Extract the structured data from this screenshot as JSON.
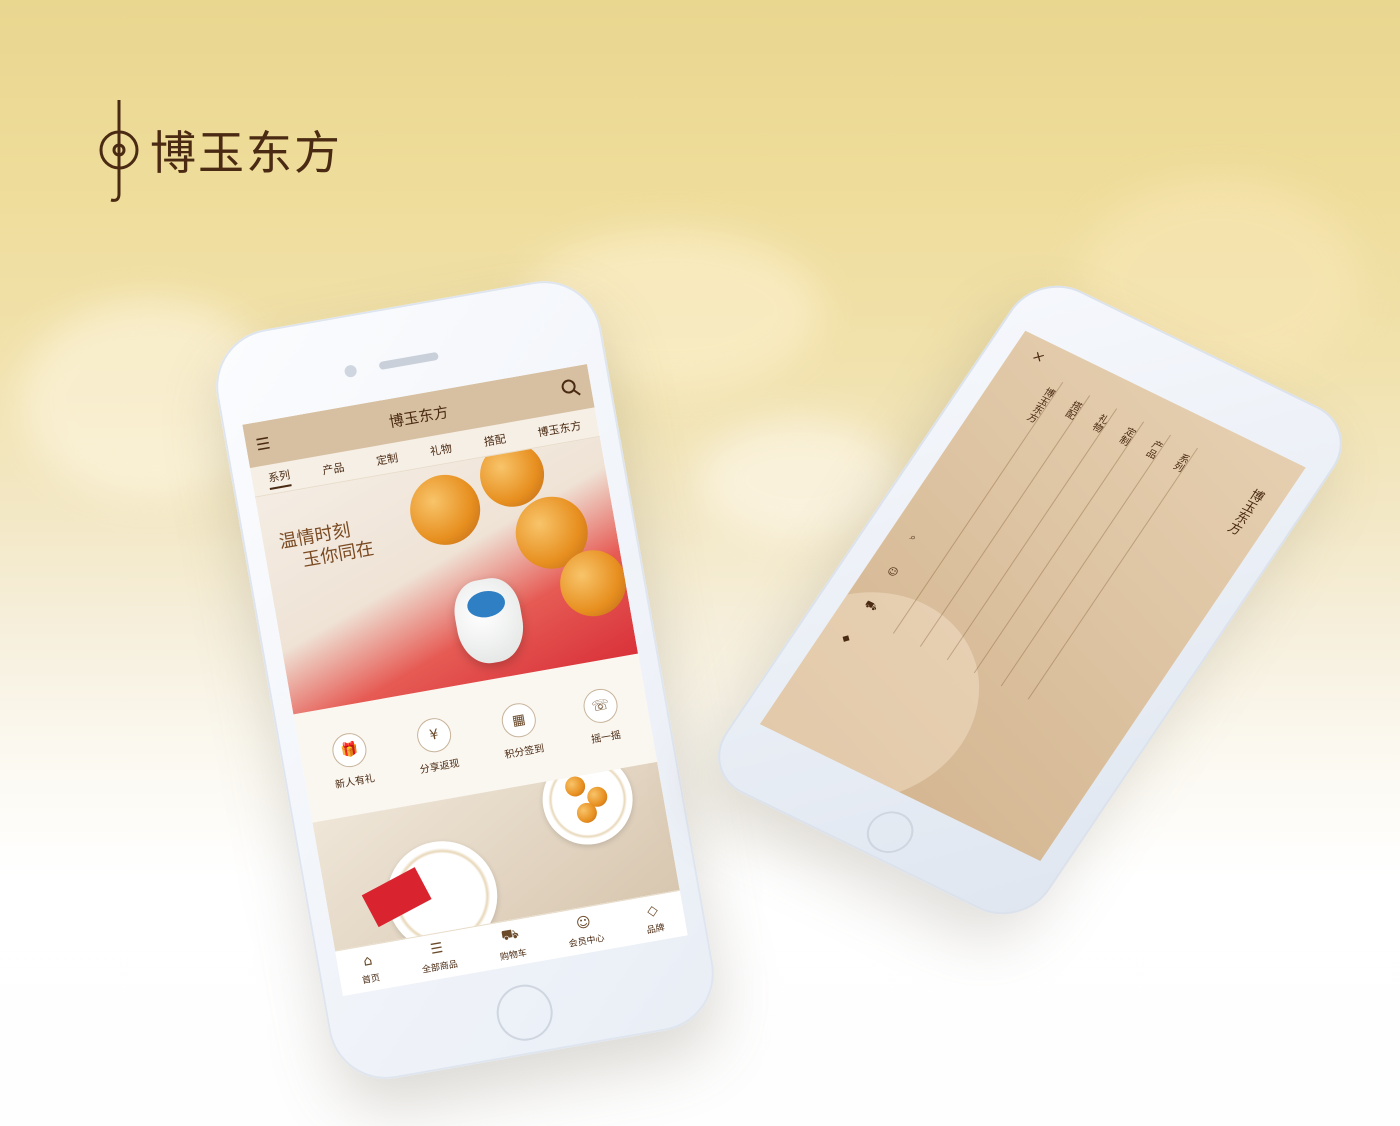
{
  "brand": {
    "name": "博玉东方"
  },
  "phone1": {
    "header": {
      "logo": "博玉东方",
      "menu_icon": "menu-icon",
      "search_icon": "search-icon"
    },
    "tabs": [
      {
        "label": "系列",
        "active": true
      },
      {
        "label": "产品"
      },
      {
        "label": "定制"
      },
      {
        "label": "礼物"
      },
      {
        "label": "搭配"
      },
      {
        "label": "博玉东方"
      }
    ],
    "banner": {
      "line1": "温情时刻",
      "line2": "玉你同在"
    },
    "quick_icons": [
      {
        "label": "新人有礼",
        "icon": "gift-icon",
        "glyph": "🎁"
      },
      {
        "label": "分享返现",
        "icon": "currency-icon",
        "glyph": "¥"
      },
      {
        "label": "积分签到",
        "icon": "calendar-icon",
        "glyph": "▦"
      },
      {
        "label": "摇一摇",
        "icon": "phone-shake-icon",
        "glyph": "☏"
      }
    ],
    "bottom_nav": [
      {
        "label": "首页",
        "icon": "home-icon",
        "glyph": "⌂"
      },
      {
        "label": "全部商品",
        "icon": "list-icon",
        "glyph": "☰"
      },
      {
        "label": "购物车",
        "icon": "cart-icon",
        "glyph": "⛟"
      },
      {
        "label": "会员中心",
        "icon": "user-icon",
        "glyph": "☺"
      },
      {
        "label": "品牌",
        "icon": "tag-icon",
        "glyph": "◇"
      }
    ]
  },
  "phone2": {
    "logo": "博玉东方",
    "close": "×",
    "menu": [
      "系列",
      "产品",
      "定制",
      "礼物",
      "搭配",
      "博玉东方"
    ],
    "side_icons": [
      "search-icon",
      "user-icon",
      "cart-icon",
      "bag-icon"
    ]
  }
}
